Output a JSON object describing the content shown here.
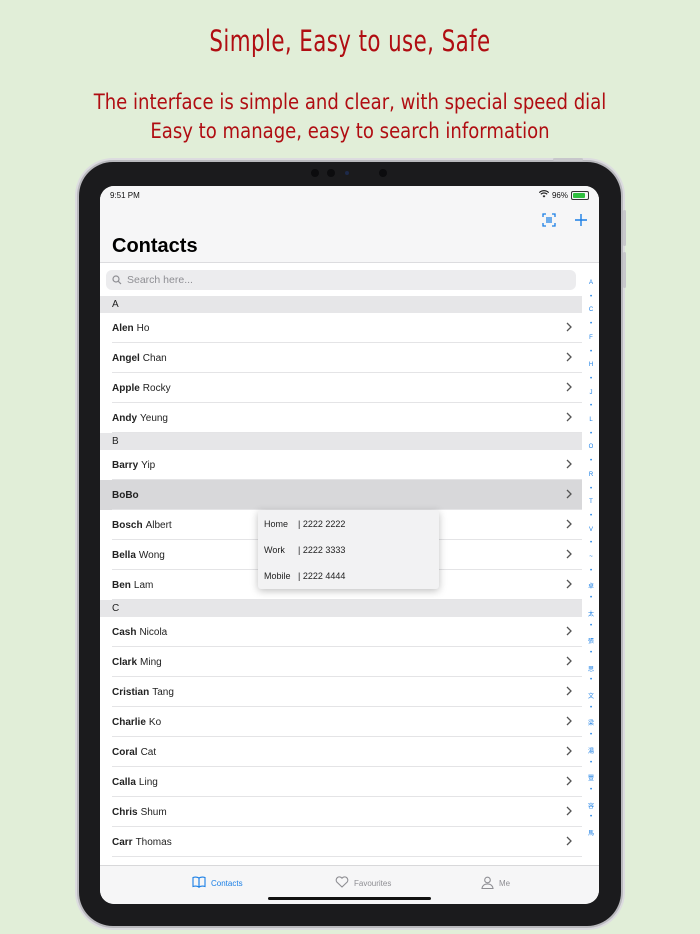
{
  "promo": {
    "headline": "Simple, Easy to use, Safe",
    "subline1": "The interface is simple and clear, with special speed dial",
    "subline2": "Easy to manage, easy to search information"
  },
  "status_bar": {
    "time": "9:51 PM",
    "battery": "96%"
  },
  "nav": {
    "title": "Contacts"
  },
  "search": {
    "placeholder": "Search here..."
  },
  "sections": [
    {
      "header": "A",
      "rows": [
        {
          "first": "Alen",
          "last": "Ho"
        },
        {
          "first": "Angel",
          "last": "Chan"
        },
        {
          "first": "Apple",
          "last": "Rocky"
        },
        {
          "first": "Andy",
          "last": "Yeung"
        }
      ]
    },
    {
      "header": "B",
      "rows": [
        {
          "first": "Barry",
          "last": "Yip"
        },
        {
          "first": "BoBo",
          "last": ""
        },
        {
          "first": "Bosch",
          "last": "Albert"
        },
        {
          "first": "Bella",
          "last": "Wong"
        },
        {
          "first": "Ben",
          "last": "Lam"
        }
      ]
    },
    {
      "header": "C",
      "rows": [
        {
          "first": "Cash",
          "last": "Nicola"
        },
        {
          "first": "Clark",
          "last": "Ming"
        },
        {
          "first": "Cristian",
          "last": "Tang"
        },
        {
          "first": "Charlie",
          "last": "Ko"
        },
        {
          "first": "Coral",
          "last": "Cat"
        },
        {
          "first": "Calla",
          "last": "Ling"
        },
        {
          "first": "Chris",
          "last": "Shum"
        },
        {
          "first": "Carr",
          "last": "Thomas"
        }
      ]
    }
  ],
  "speed_dial": [
    {
      "label": "Home",
      "number": "| 2222 2222"
    },
    {
      "label": "Work",
      "number": "| 2222 3333"
    },
    {
      "label": "Mobile",
      "number": "| 2222 4444"
    }
  ],
  "index": [
    "A",
    "•",
    "C",
    "•",
    "F",
    "•",
    "H",
    "•",
    "J",
    "•",
    "L",
    "•",
    "O",
    "•",
    "R",
    "•",
    "T",
    "•",
    "V",
    "•",
    "~",
    "•",
    "卓",
    "•",
    "太",
    "•",
    "張",
    "•",
    "思",
    "•",
    "文",
    "•",
    "梁",
    "•",
    "湯",
    "•",
    "豐",
    "•",
    "容",
    "•",
    "馬"
  ],
  "tabs": [
    {
      "label": "Contacts",
      "icon": "book-icon"
    },
    {
      "label": "Favourites",
      "icon": "heart-icon"
    },
    {
      "label": "Me",
      "icon": "person-icon"
    }
  ],
  "colors": {
    "accent": "#1a7fe6",
    "promo_text": "#b00d12",
    "background": "#e1eed8"
  }
}
